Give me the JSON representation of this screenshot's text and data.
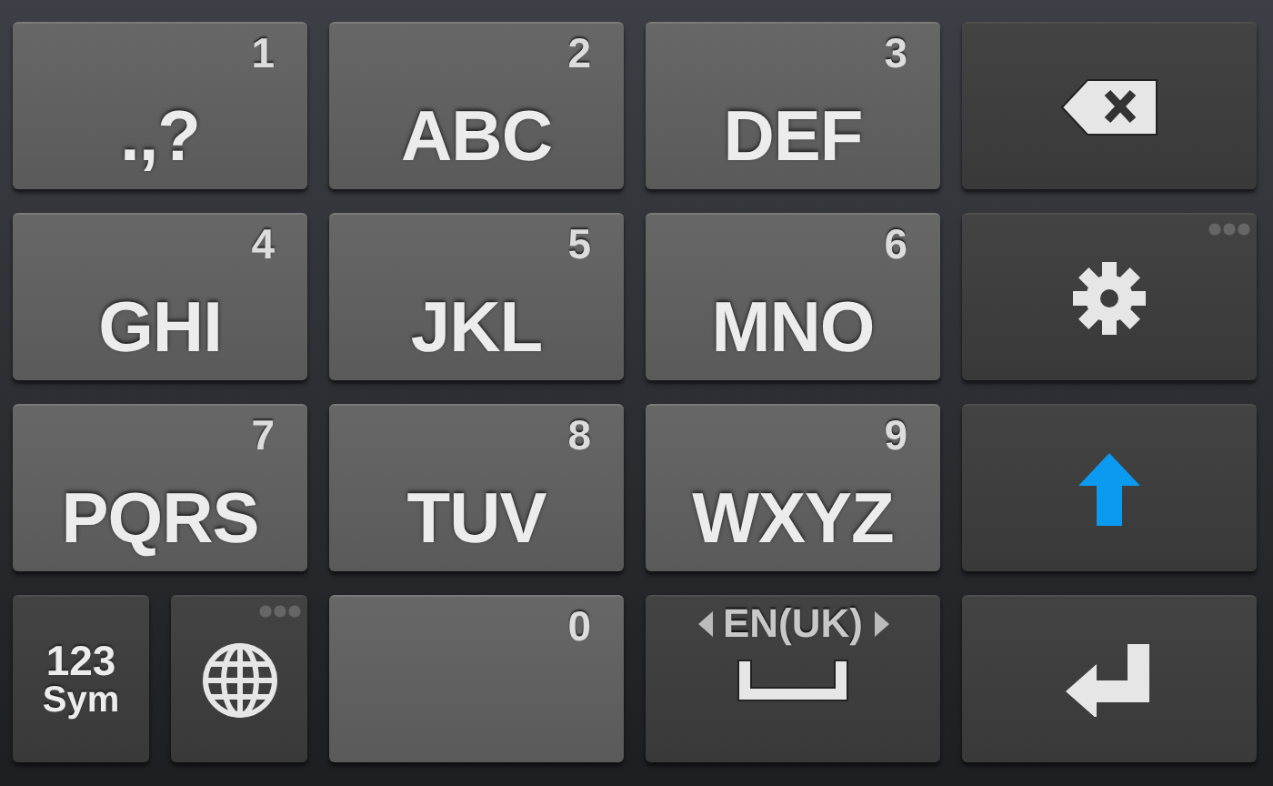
{
  "keyboard": {
    "rows": [
      {
        "keys": [
          {
            "kind": "letter",
            "label": ".,?",
            "digit": "1"
          },
          {
            "kind": "letter",
            "label": "ABC",
            "digit": "2"
          },
          {
            "kind": "letter",
            "label": "DEF",
            "digit": "3"
          },
          {
            "kind": "delete",
            "has_more": false
          }
        ]
      },
      {
        "keys": [
          {
            "kind": "letter",
            "label": "GHI",
            "digit": "4"
          },
          {
            "kind": "letter",
            "label": "JKL",
            "digit": "5"
          },
          {
            "kind": "letter",
            "label": "MNO",
            "digit": "6"
          },
          {
            "kind": "settings",
            "has_more": true
          }
        ]
      },
      {
        "keys": [
          {
            "kind": "letter",
            "label": "PQRS",
            "digit": "7"
          },
          {
            "kind": "letter",
            "label": "TUV",
            "digit": "8"
          },
          {
            "kind": "letter",
            "label": "WXYZ",
            "digit": "9"
          },
          {
            "kind": "shift",
            "has_more": false
          }
        ]
      },
      {
        "keys": [
          {
            "kind": "symbols",
            "lines": [
              "123",
              "Sym"
            ],
            "has_more": false
          },
          {
            "kind": "globe",
            "has_more": true
          },
          {
            "kind": "letter",
            "digit": "0"
          },
          {
            "kind": "language",
            "label": "EN(UK)",
            "has_more": false
          },
          {
            "kind": "enter",
            "has_more": false
          }
        ]
      }
    ]
  }
}
